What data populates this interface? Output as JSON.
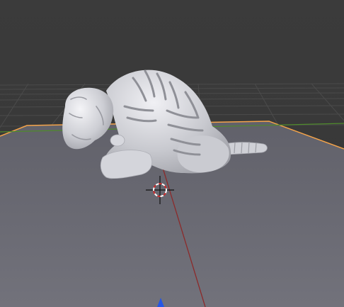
{
  "viewport": {
    "type": "3d-viewport",
    "background_color": "#393939",
    "grid_line_color": "#4a4a4a",
    "ground_plane": {
      "fill_color": "#6a6a73",
      "selected_outline_color": "#f5a44a"
    },
    "axes": {
      "x_axis_color": "#8c2a2a",
      "y_axis_color": "#4f8a2c"
    },
    "object": {
      "icon": "sculpted-mesh-object",
      "color": "#cfd0d6"
    },
    "cursor_3d": {
      "icon": "crosshair-3d-cursor-icon",
      "ring_colors": [
        "#ffffff",
        "#d12a2a"
      ]
    },
    "navigation_marker": {
      "icon": "blue-triangle-icon",
      "color": "#2456e6"
    }
  }
}
